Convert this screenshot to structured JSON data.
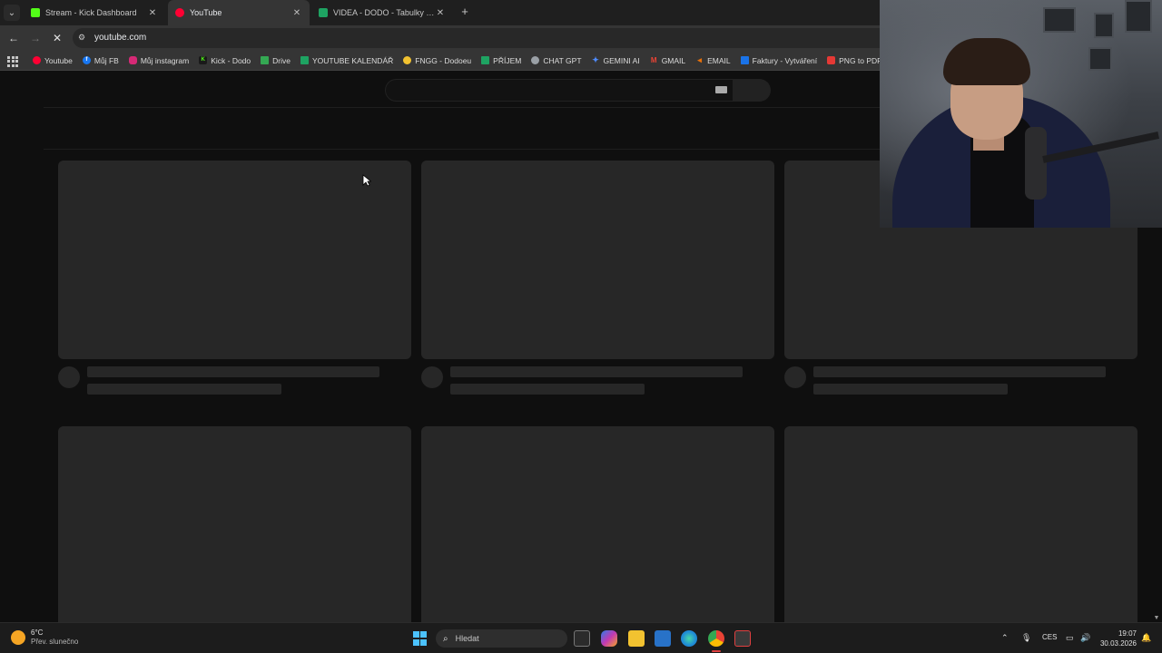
{
  "browser": {
    "tabs": [
      {
        "title": "Stream - Kick Dashboard",
        "favicon": "kick-icon",
        "color": "#53fc18",
        "active": false
      },
      {
        "title": "YouTube",
        "favicon": "youtube-icon",
        "color": "#ff0033",
        "active": true
      },
      {
        "title": "VIDEA - DODO - Tabulky Googl",
        "favicon": "sheets-icon",
        "color": "#1ea362",
        "active": false
      }
    ],
    "new_tab": "+",
    "address": "youtube.com",
    "bookmarks": [
      {
        "label": "Youtube",
        "icon": "youtube-icon",
        "color": "#ff0033"
      },
      {
        "label": "Můj FB",
        "icon": "facebook-icon",
        "color": "#1877f2"
      },
      {
        "label": "Můj instagram",
        "icon": "instagram-icon",
        "color": "#d62976"
      },
      {
        "label": "Kick - Dodo",
        "icon": "kick-icon",
        "color": "#53fc18"
      },
      {
        "label": "Drive",
        "icon": "drive-icon",
        "color": "#34a853"
      },
      {
        "label": "YOUTUBE KALENDÁŘ",
        "icon": "sheets-icon",
        "color": "#1ea362"
      },
      {
        "label": "FNGG - Dodoeu",
        "icon": "fngg-icon",
        "color": "#f2c230"
      },
      {
        "label": "PŘÍJEM",
        "icon": "sheets-icon",
        "color": "#1ea362"
      },
      {
        "label": "CHAT GPT",
        "icon": "chatgpt-icon",
        "color": "#9aa0a6"
      },
      {
        "label": "GEMINI AI",
        "icon": "gemini-icon",
        "color": "#4f8cff"
      },
      {
        "label": "GMAIL",
        "icon": "gmail-icon",
        "color": "#ea4335"
      },
      {
        "label": "EMAIL",
        "icon": "email-icon",
        "color": "#e8710a"
      },
      {
        "label": "Faktury - Vytváření",
        "icon": "invoice-icon",
        "color": "#1a73e8"
      },
      {
        "label": "PNG to PDF",
        "icon": "pdf-icon",
        "color": "#e53935"
      }
    ]
  },
  "taskbar": {
    "weather_temp": "6°C",
    "weather_desc": "Přev. slunečno",
    "search_placeholder": "Hledat",
    "language": "CES",
    "time": "19:07",
    "date": "30.03.2026"
  },
  "colors": {
    "page_bg": "#0f0f0f",
    "skeleton": "#272727",
    "browser_chrome": "#353535"
  }
}
